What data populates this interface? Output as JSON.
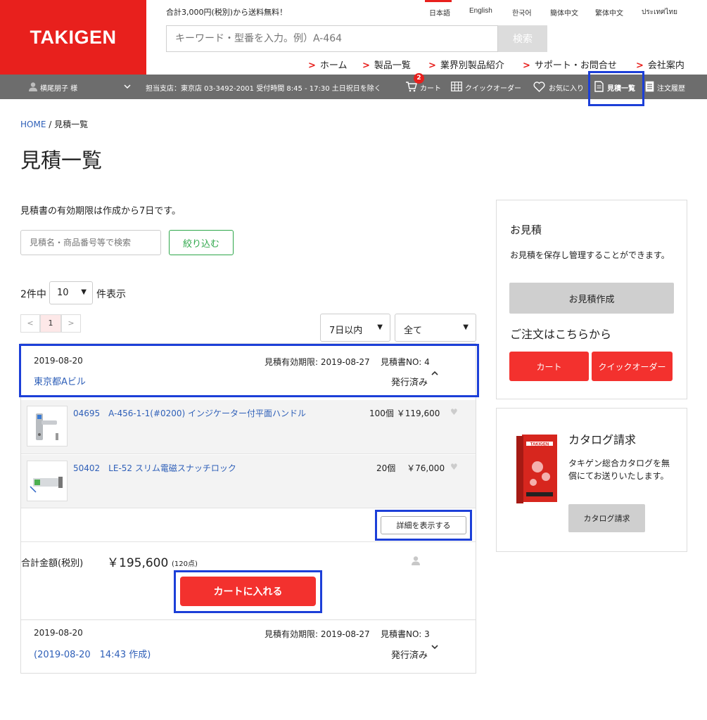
{
  "header": {
    "logo": "TAKIGEN",
    "free_shipping": "合計3,000円(税別)から送料無料！",
    "languages": [
      "日本語",
      "English",
      "한국어",
      "簡体中文",
      "繁体中文",
      "ประเทศไทย"
    ],
    "search_placeholder": "キーワード・型番を入力。例）A-464",
    "search_button": "検索",
    "nav": [
      "ホーム",
      "製品一覧",
      "業界別製品紹介",
      "サポート・お問合せ",
      "会社案内"
    ]
  },
  "userbar": {
    "user_name": "横尾朋子 様",
    "branch_info": "担当支店：東京店 03-3492-2001 受付時間 8:45 - 17:30 土日祝日を除く",
    "cart_label": "カート",
    "cart_count": "2",
    "quick_order": "クイックオーダー",
    "favorites": "お気に入り",
    "quotes": "見積一覧",
    "order_history": "注文履歴"
  },
  "main": {
    "breadcrumb_home": "HOME",
    "breadcrumb_sep": "/",
    "breadcrumb_current": "見積一覧",
    "title": "見積一覧",
    "validity_note": "見積書の有効期限は作成から7日です。",
    "filter_placeholder": "見積名・商品番号等で検索",
    "filter_button": "絞り込む",
    "count_pre": "2件中",
    "per_page": "10",
    "count_post": "件表示",
    "page_prev": "<",
    "page_current": "1",
    "page_next": ">",
    "period_select": "7日以内",
    "status_select": "全て"
  },
  "quotes": [
    {
      "date": "2019-08-20",
      "expiry": "見積有効期限: 2019-08-27",
      "quote_no": "見積書NO: 4",
      "name": "東京都Aビル",
      "status": "発行済み",
      "items": [
        {
          "name": "04695　A-456-1-1(#0200) インジケーター付平面ハンドル",
          "qty_price": "100個 ￥119,600"
        },
        {
          "name": "50402　LE-52 スリム電磁スナッチロック",
          "qty_price": "20個 　￥76,000"
        }
      ],
      "detail_button": "詳細を表示する",
      "total_label": "合計金額(税別)",
      "total_amount": "￥195,600",
      "total_points": "(120点)",
      "cart_button": "カートに入れる"
    },
    {
      "date": "2019-08-20",
      "expiry": "見積有効期限: 2019-08-27",
      "quote_no": "見積書NO: 3",
      "name": "(2019-08-20　14:43 作成)",
      "status": "発行済み"
    }
  ],
  "sidebar": {
    "estimate_title": "お見積",
    "estimate_desc": "お見積を保存し管理することができます。",
    "estimate_button": "お見積作成",
    "order_title": "ご注文はこちらから",
    "cart_button": "カート",
    "quick_order_button": "クイックオーダー",
    "catalog_title": "カタログ請求",
    "catalog_desc": "タキゲン総合カタログを無償にてお送りいたします。",
    "catalog_button": "カタログ請求",
    "catalog_cover_text": "TAKIGEN"
  },
  "icons": {
    "nav_chevron": ">",
    "expand_up": "⌃",
    "expand_down": "⌄",
    "dropdown": "▼",
    "heart": "♥"
  },
  "colors": {
    "brand_red": "#e8201d",
    "link_blue": "#2e5fb8",
    "filter_green": "#2ea74a",
    "dark_bar": "#6d6d6d",
    "highlight": "#1c3fd8"
  }
}
